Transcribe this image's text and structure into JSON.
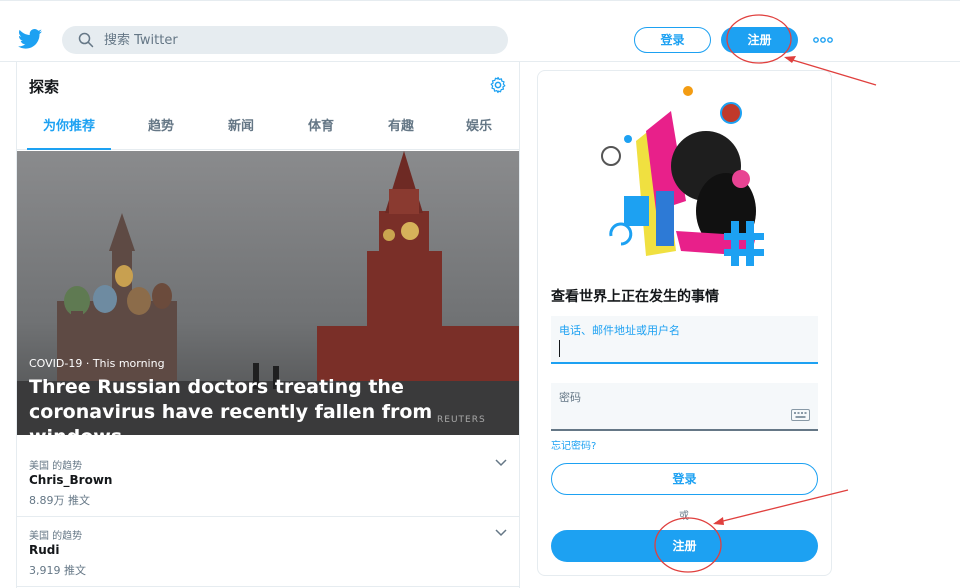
{
  "header": {
    "search_placeholder": "搜索 Twitter",
    "login_label": "登录",
    "signup_label": "注册"
  },
  "explore": {
    "title": "探索",
    "tabs": [
      {
        "label": "为你推荐",
        "active": true
      },
      {
        "label": "趋势",
        "active": false
      },
      {
        "label": "新闻",
        "active": false
      },
      {
        "label": "体育",
        "active": false
      },
      {
        "label": "有趣",
        "active": false
      },
      {
        "label": "娱乐",
        "active": false
      }
    ],
    "hero": {
      "meta": "COVID-19 · This morning",
      "headline": "Three Russian doctors treating the coronavirus have recently fallen from windows",
      "watermark": "REUTERS"
    },
    "trends": [
      {
        "context": "美国 的趋势",
        "name": "Chris_Brown",
        "count": "8.89万 推文"
      },
      {
        "context": "美国 的趋势",
        "name": "Rudi",
        "count": "3,919 推文"
      }
    ]
  },
  "signup_card": {
    "title": "查看世界上正在发生的事情",
    "phone_label": "电话、邮件地址或用户名",
    "password_label": "密码",
    "forgot_link": "忘记密码?",
    "login_button": "登录",
    "or_text": "或",
    "signup_button": "注册"
  },
  "colors": {
    "brand": "#1da1f2",
    "annotation": "#e0403e"
  }
}
